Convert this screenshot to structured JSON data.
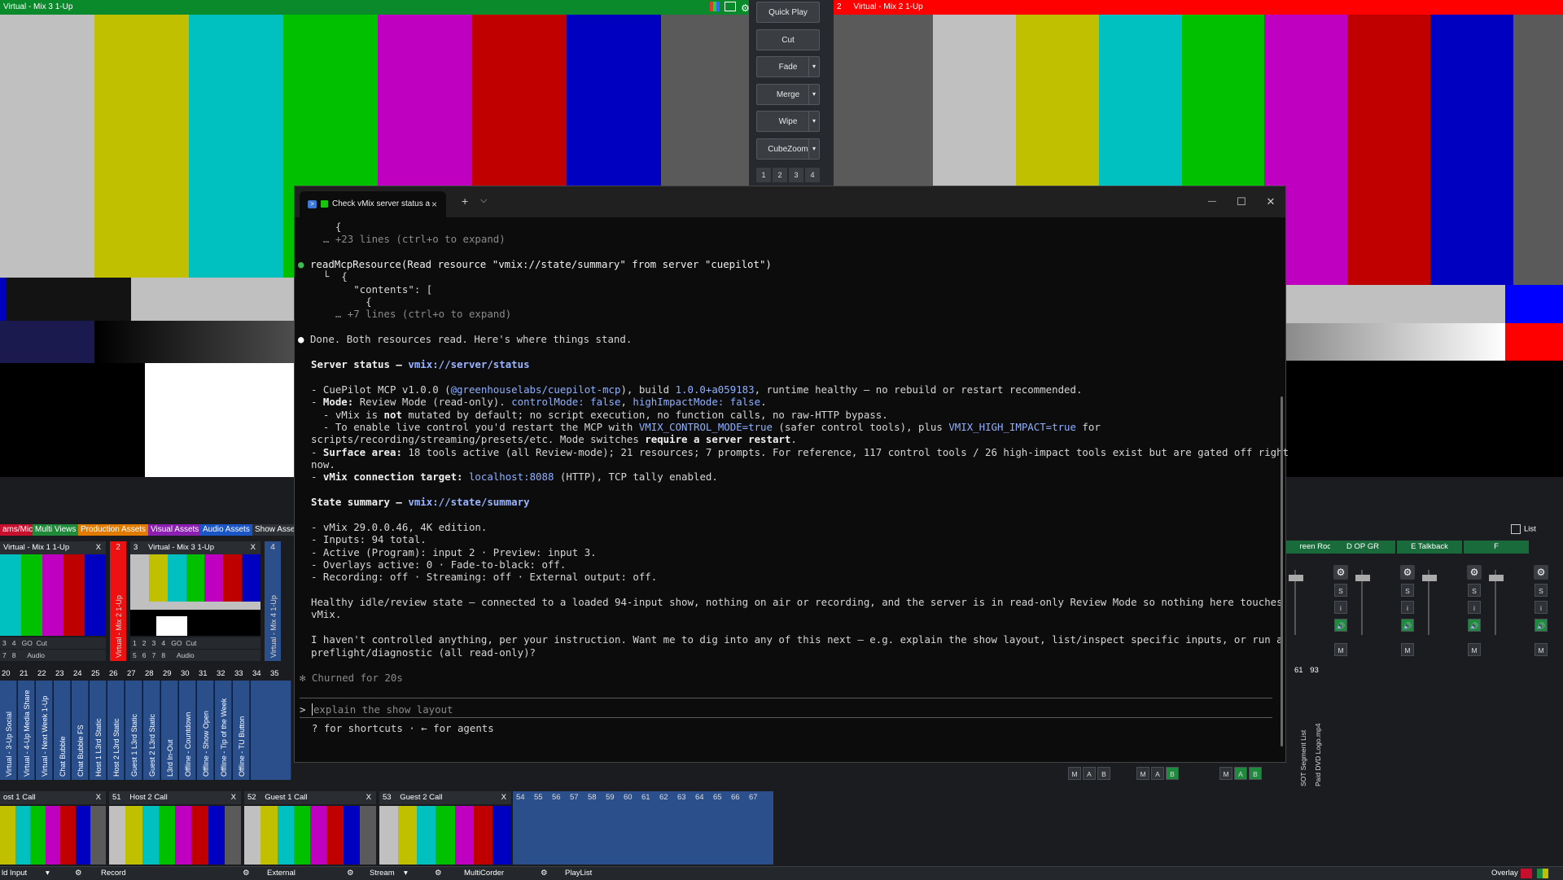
{
  "preview": {
    "title": "Virtual - Mix 3 1-Up"
  },
  "program": {
    "number": "2",
    "title": "Virtual - Mix 2 1-Up"
  },
  "transitions": {
    "quick_play": "Quick Play",
    "cut": "Cut",
    "fade": "Fade",
    "merge": "Merge",
    "wipe": "Wipe",
    "cubezoom": "CubeZoom",
    "numbers": [
      "1",
      "2",
      "3",
      "4"
    ]
  },
  "terminal": {
    "tab_title": "Check vMix server status a",
    "new_tab": "+",
    "dropdown": "⌵",
    "close_tab": "×",
    "minimize": "—",
    "maximize": "☐",
    "close": "✕",
    "lines": {
      "l1": "    {",
      "l2": "  … +23 lines (ctrl+o to expand)",
      "l3_dot": "●",
      "l3": "readMcpResource(Read resource \"vmix://state/summary\" from server \"cuepilot\")",
      "l4": "  └  {",
      "l5": "       \"contents\": [",
      "l6": "         {",
      "l7": "    … +7 lines (ctrl+o to expand)",
      "l8_dot": "●",
      "l8": "Done. Both resources read. Here's where things stand.",
      "s1_label": "Server status — ",
      "s1_link": "vmix://server/status",
      "b1_a": "- CuePilot MCP v1.0.0 (",
      "b1_b": "@greenhouselabs/cuepilot-mcp",
      "b1_c": "), build ",
      "b1_d": "1.0.0+a059183",
      "b1_e": ", runtime healthy — no rebuild or restart recommended.",
      "b2_a": "- ",
      "b2_b": "Mode:",
      "b2_c": " Review Mode (read-only). ",
      "b2_d": "controlMode: false",
      "b2_e": ", ",
      "b2_f": "highImpactMode: false",
      "b2_g": ".",
      "b3_a": "  - vMix is ",
      "b3_b": "not",
      "b3_c": " mutated by default; no script execution, no function calls, no raw-HTTP bypass.",
      "b4_a": "  - To enable live control you'd restart the MCP with ",
      "b4_b": "VMIX_CONTROL_MODE=true",
      "b4_c": " (safer control tools), plus ",
      "b4_d": "VMIX_HIGH_IMPACT=true",
      "b4_e": " for",
      "b5_a": "scripts/recording/streaming/presets/etc. Mode switches ",
      "b5_b": "require a server restart",
      "b5_c": ".",
      "b6_a": "- ",
      "b6_b": "Surface area:",
      "b6_c": " 18 tools active (all Review-mode); 21 resources; 7 prompts. For reference, 117 control tools / 26 high-impact tools exist but are gated off right",
      "b7": "now.",
      "b8_a": "- ",
      "b8_b": "vMix connection target:",
      "b8_c": " ",
      "b8_d": "localhost:8088",
      "b8_e": " (HTTP), TCP tally enabled.",
      "s2_label": "State summary — ",
      "s2_link": "vmix://state/summary",
      "c1": "- vMix 29.0.0.46, 4K edition.",
      "c2": "- Inputs: 94 total.",
      "c3": "- Active (Program): input 2 · Preview: input 3.",
      "c4": "- Overlays active: 0 · Fade-to-black: off.",
      "c5": "- Recording: off · Streaming: off · External output: off.",
      "p1": "Healthy idle/review state — connected to a loaded 94-input show, nothing on air or recording, and the server is in read-only Review Mode so nothing here touches",
      "p2": "vMix.",
      "q1": "I haven't controlled anything, per your instruction. Want me to dig into any of this next — e.g. explain the show layout, list/inspect specific inputs, or run a",
      "q2": "preflight/diagnostic (all read-only)?",
      "churn": "✻ Churned for 20s",
      "prompt": ">",
      "input_text": "explain the show layout",
      "help": "  ? for shortcuts · ← for agents"
    }
  },
  "categories": [
    "ams/Mics",
    "Multi Views",
    "Production Assets",
    "Visual Assets",
    "Audio Assets",
    "Show Asse"
  ],
  "inputs": {
    "i1": {
      "title": "Virtual - Mix 1 1-Up",
      "x": "X"
    },
    "i2": {
      "number": "2",
      "title": "Virtual - Mix 2 1-Up"
    },
    "i3": {
      "number": "3",
      "title": "Virtual - Mix 3 1-Up",
      "x": "X"
    },
    "i4": {
      "number": "4",
      "title": "Virtual - Mix 4 1-Up"
    },
    "i50": {
      "title": "ost 1 Call",
      "x": "X"
    },
    "i51": {
      "number": "51",
      "title": "Host 2 Call",
      "x": "X"
    },
    "i52": {
      "number": "52",
      "title": "Guest 1 Call",
      "x": "X"
    },
    "i53": {
      "number": "53",
      "title": "Guest 2 Call",
      "x": "X"
    }
  },
  "ctrl_labels": {
    "row1": "3   4   GO  Cut",
    "row2": "7   8      Audio",
    "row3": "1   2   3   4   GO  Cut",
    "row4": "5   6   7   8      Audio"
  },
  "numbers_top": [
    "20",
    "21",
    "22",
    "23",
    "24",
    "25",
    "26",
    "27",
    "28",
    "29",
    "30",
    "31",
    "32",
    "33",
    "34",
    "35"
  ],
  "numbers_bottom": [
    "54",
    "55",
    "56",
    "57",
    "58",
    "59",
    "60",
    "61",
    "62",
    "63",
    "64",
    "65",
    "66",
    "67"
  ],
  "vertical_labels": [
    "Virtual - 3-Up Social",
    "Virtual - 4-Up Media Share",
    "Virtual - Next Week 1-Up",
    "Chat Bubble",
    "Chat Bubble FS",
    "Host 1 L3rd Static",
    "Host 2 L3rd Static",
    "Guest 1 L3rd Static",
    "Guest 2 L3rd Static",
    "L3rd In-Out",
    "Offline - Countdown",
    "Offline - Show Open",
    "Offline - Tip of the Week",
    "Offline - TU Button"
  ],
  "audio": {
    "channels": [
      "reen Room",
      "D OP GR",
      "E Talkback",
      "F"
    ],
    "list_label": "List",
    "buttons": {
      "s": "S",
      "i": "i",
      "m": "M",
      "a": "A",
      "b": "B"
    },
    "numbers": [
      "61",
      "93"
    ],
    "side_labels": [
      "SOT Segment List",
      "Paid DVD Logo.mp4"
    ]
  },
  "bottom": {
    "ld_input": "ld Input",
    "record": "Record",
    "external": "External",
    "stream": "Stream",
    "multicorder": "MultiCorder",
    "playlist": "PlayList",
    "overlay": "Overlay"
  },
  "colors": {
    "accent_green": "#3fb950",
    "program_red": "#ff0000",
    "preview_green": "#0a8a2a",
    "link_blue": "#9ab4ff"
  }
}
